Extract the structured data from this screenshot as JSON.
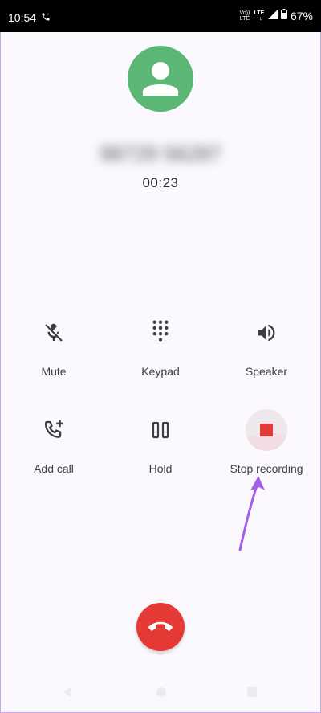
{
  "status_bar": {
    "time": "10:54",
    "volte_top": "Vo))",
    "volte_bottom": "LTE",
    "lte_top": "LTE",
    "lte_bottom": "↑↓",
    "battery": "67%"
  },
  "call": {
    "caller_name": "98729 56287",
    "duration": "00:23"
  },
  "controls": {
    "mute": "Mute",
    "keypad": "Keypad",
    "speaker": "Speaker",
    "add_call": "Add call",
    "hold": "Hold",
    "stop_recording": "Stop recording"
  },
  "colors": {
    "avatar": "#5cb674",
    "end_call": "#e53935",
    "record": "#e53935",
    "annotation_arrow": "#a35ee8"
  },
  "icons": {
    "status": "phone-call-icon",
    "mute": "mic-off-icon",
    "keypad": "dialpad-icon",
    "speaker": "volume-icon",
    "add_call": "add-call-icon",
    "hold": "pause-icon",
    "stop_recording": "stop-icon",
    "end_call": "call-end-icon"
  }
}
